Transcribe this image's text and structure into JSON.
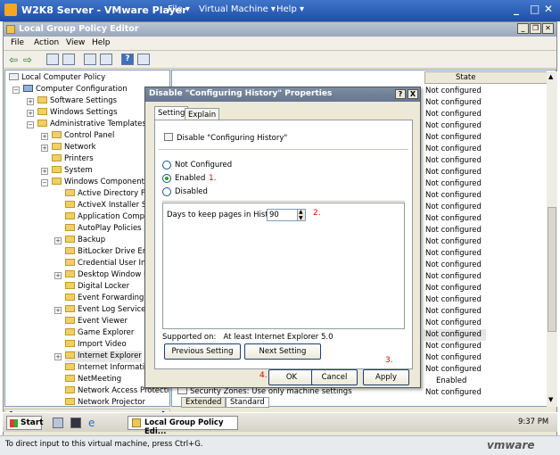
{
  "vm": {
    "title": "W2K8 Server - VMware Player",
    "menu": [
      "File ▾",
      "Virtual Machine ▾",
      "Help ▾"
    ],
    "status_text": "To direct input to this virtual machine, press Ctrl+G.",
    "logo": "vmware"
  },
  "mmc": {
    "title": "Local Group Policy Editor",
    "menu": [
      "File",
      "Action",
      "View",
      "Help"
    ],
    "state_header": "State",
    "tabs": [
      "Extended",
      "Standard"
    ],
    "footer_item": "Security Zones: Use only machine settings"
  },
  "tree": [
    "Local Computer Policy",
    "Computer Configuration",
    "Software Settings",
    "Windows Settings",
    "Administrative Templates",
    "Control Panel",
    "Network",
    "Printers",
    "System",
    "Windows Components",
    "Active Directory Fed",
    "ActiveX Installer Ser",
    "Application Compatit",
    "AutoPlay Policies",
    "Backup",
    "BitLocker Drive Encr",
    "Credential User Inte",
    "Desktop Window Ma",
    "Digital Locker",
    "Event Forwarding",
    "Event Log Service",
    "Event Viewer",
    "Game Explorer",
    "Import Video",
    "Internet Explorer",
    "Internet Informatior",
    "NetMeeting",
    "Network Access Protectic",
    "Network Projector"
  ],
  "states": [
    "Not configured",
    "Not configured",
    "Not configured",
    "Not configured",
    "Not configured",
    "Not configured",
    "Not configured",
    "Not configured",
    "Not configured",
    "Not configured",
    "Not configured",
    "Not configured",
    "Not configured",
    "Not configured",
    "Not configured",
    "Not configured",
    "Not configured",
    "Not configured",
    "Not configured",
    "Not configured",
    "Not configured",
    "Not configured",
    "Not configured",
    "Not configured",
    "Not configured",
    "Enabled",
    "Not configured"
  ],
  "dialog": {
    "title": "Disable \"Configuring History\" Properties",
    "help": "?",
    "close": "X",
    "tab_setting": "Setting",
    "tab_explain": "Explain",
    "policy_name": "Disable \"Configuring History\"",
    "radio_not_configured": "Not Configured",
    "radio_enabled": "Enabled",
    "radio_disabled": "Disabled",
    "days_label": "Days to keep pages in History",
    "days_value": "90",
    "supported_label": "Supported on:",
    "supported_value": "At least Internet Explorer 5.0",
    "prev": "Previous Setting",
    "next": "Next Setting",
    "ok": "OK",
    "cancel": "Cancel",
    "apply": "Apply",
    "annot1": "1.",
    "annot2": "2.",
    "annot3": "3.",
    "annot4": "4."
  },
  "taskbar": {
    "start": "Start",
    "task": "Local Group Policy Edi...",
    "clock": "9:37 PM"
  }
}
